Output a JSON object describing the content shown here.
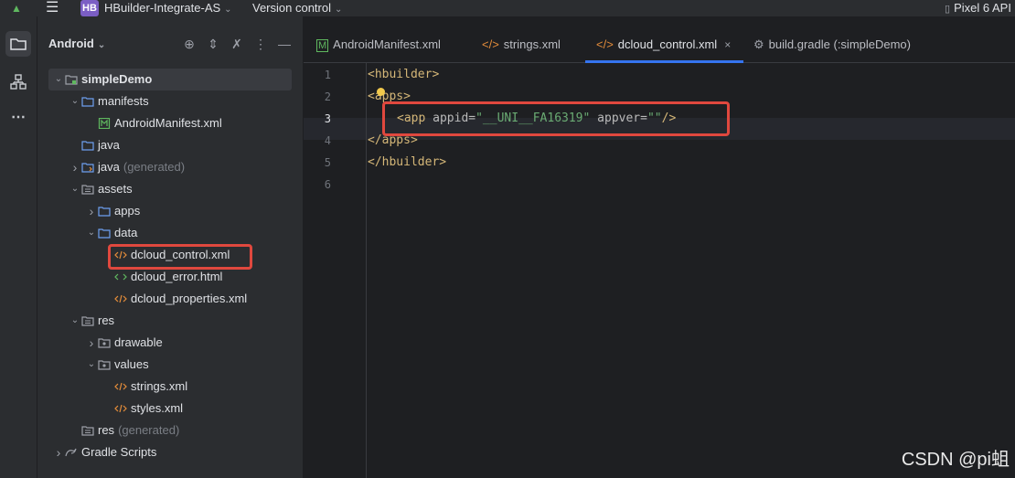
{
  "topbar": {
    "menu_icon": "hamburger-icon",
    "project_badge": "HB",
    "project_name": "HBuilder-Integrate-AS",
    "vcs_label": "Version control",
    "device_label": "Pixel 6 API"
  },
  "toolstrip": {
    "icons": [
      "project-folder-icon",
      "structure-icon",
      "more-icon"
    ]
  },
  "project_panel": {
    "title": "Android",
    "header_icons": [
      "locate-icon",
      "expand-collapse-icon",
      "close-icon",
      "options-icon",
      "minimize-icon"
    ],
    "tree": [
      {
        "label": "simpleDemo",
        "suffix": "",
        "arrow": "down",
        "icon": "module-folder-icon"
      },
      {
        "label": "manifests",
        "suffix": "",
        "arrow": "down",
        "icon": "folder-icon"
      },
      {
        "label": "AndroidManifest.xml",
        "suffix": "",
        "arrow": "",
        "icon": "manifest-file-icon"
      },
      {
        "label": "java",
        "suffix": "",
        "arrow": "",
        "icon": "folder-icon"
      },
      {
        "label": "java",
        "suffix": "(generated)",
        "arrow": "right",
        "icon": "generated-folder-icon"
      },
      {
        "label": "assets",
        "suffix": "",
        "arrow": "down",
        "icon": "resource-folder-icon"
      },
      {
        "label": "apps",
        "suffix": "",
        "arrow": "right",
        "icon": "folder-icon"
      },
      {
        "label": "data",
        "suffix": "",
        "arrow": "down",
        "icon": "folder-icon"
      },
      {
        "label": "dcloud_control.xml",
        "suffix": "",
        "arrow": "",
        "icon": "xml-file-icon"
      },
      {
        "label": "dcloud_error.html",
        "suffix": "",
        "arrow": "",
        "icon": "html-file-icon"
      },
      {
        "label": "dcloud_properties.xml",
        "suffix": "",
        "arrow": "",
        "icon": "xml-file-icon"
      },
      {
        "label": "res",
        "suffix": "",
        "arrow": "down",
        "icon": "resource-folder-icon"
      },
      {
        "label": "drawable",
        "suffix": "",
        "arrow": "right",
        "icon": "package-folder-icon"
      },
      {
        "label": "values",
        "suffix": "",
        "arrow": "down",
        "icon": "package-folder-icon"
      },
      {
        "label": "strings.xml",
        "suffix": "",
        "arrow": "",
        "icon": "xml-file-icon"
      },
      {
        "label": "styles.xml",
        "suffix": "",
        "arrow": "",
        "icon": "xml-file-icon"
      },
      {
        "label": "res",
        "suffix": "(generated)",
        "arrow": "",
        "icon": "resource-folder-icon"
      },
      {
        "label": "Gradle Scripts",
        "suffix": "",
        "arrow": "right",
        "icon": "gradle-icon"
      }
    ]
  },
  "editor": {
    "tabs": [
      {
        "label": "AndroidManifest.xml",
        "icon": "manifest-file-icon",
        "active": false
      },
      {
        "label": "strings.xml",
        "icon": "xml-file-icon",
        "active": false
      },
      {
        "label": "dcloud_control.xml",
        "icon": "xml-file-icon",
        "active": true
      },
      {
        "label": "build.gradle (:simpleDemo)",
        "icon": "gradle-icon",
        "active": false
      }
    ],
    "tab_close": "×",
    "current_line": 3,
    "line_numbers": [
      "1",
      "2",
      "3",
      "4",
      "5",
      "6"
    ],
    "code": {
      "l1_open": "<hbuilder>",
      "l2_open_a": "<",
      "l2_open_b": "apps>",
      "l3_tag": "<app ",
      "l3_attr1": "appid=",
      "l3_val1": "\"__UNI__FA16319\"",
      "l3_attr2": " appver=",
      "l3_val2": "\"\"",
      "l3_close": "/>",
      "l4_close": "</apps>",
      "l5_close": "</hbuilder>"
    },
    "hint_icon": "lightbulb-icon"
  },
  "watermark": "CSDN @pi蛆"
}
